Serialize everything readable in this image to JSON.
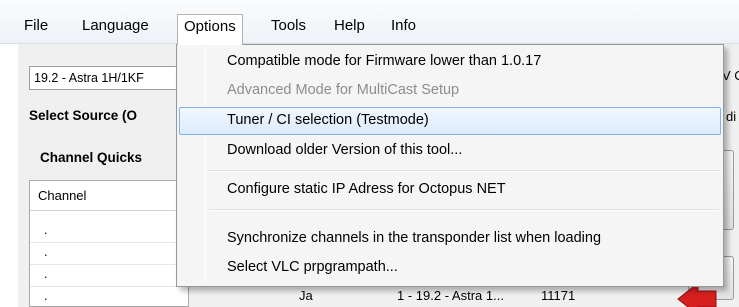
{
  "menubar": {
    "items": [
      "File",
      "Language",
      "Options",
      "Tools",
      "Help",
      "Info"
    ]
  },
  "app": {
    "source_combo_value": "19.2 - Astra 1H/1KF",
    "select_source_label": "Select Source (O",
    "quickselect_label": "Channel Quicks",
    "grid_header_channel": "Channel",
    "grid_rows": [
      ".",
      ".",
      ".",
      "."
    ],
    "right_label_1": "V C",
    "right_label_2": "di",
    "bottom_row": {
      "col_ja": "Ja",
      "col_transponder": "1 - 19.2 - Astra 1...",
      "col_freq": "11171"
    }
  },
  "options_menu": {
    "items": [
      {
        "label": "Compatible mode for Firmware lower than 1.0.17",
        "state": "normal"
      },
      {
        "label": "Advanced Mode for MultiCast Setup",
        "state": "disabled"
      },
      {
        "label": "Tuner / CI  selection (Testmode)",
        "state": "highlighted"
      },
      {
        "label": "Download older Version of this tool...",
        "state": "normal"
      },
      {
        "label": "Configure static IP Adress for Octopus NET",
        "state": "normal"
      },
      {
        "label": "Synchronize channels in the transponder list when loading",
        "state": "normal"
      },
      {
        "label": "Select VLC prpgrampath...",
        "state": "normal"
      }
    ]
  },
  "colors": {
    "highlight_border": "#7eb4ea",
    "arrow_red": "#d62020"
  }
}
